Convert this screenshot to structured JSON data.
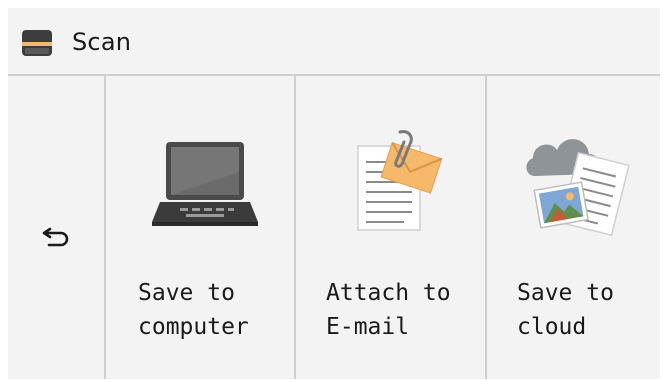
{
  "header": {
    "icon": "scanner-icon",
    "title": "Scan"
  },
  "back": {
    "icon": "back-arrow-icon"
  },
  "options": [
    {
      "icon": "laptop-icon",
      "label": "Save to\ncomputer"
    },
    {
      "icon": "email-attachment-icon",
      "label": "Attach to\nE-mail"
    },
    {
      "icon": "cloud-document-icon",
      "label": "Save to\ncloud"
    }
  ],
  "colors": {
    "background": "#f3f3f3",
    "divider": "#cfcfcf",
    "text": "#1a1a1a",
    "envelope": "#f6b96b"
  }
}
